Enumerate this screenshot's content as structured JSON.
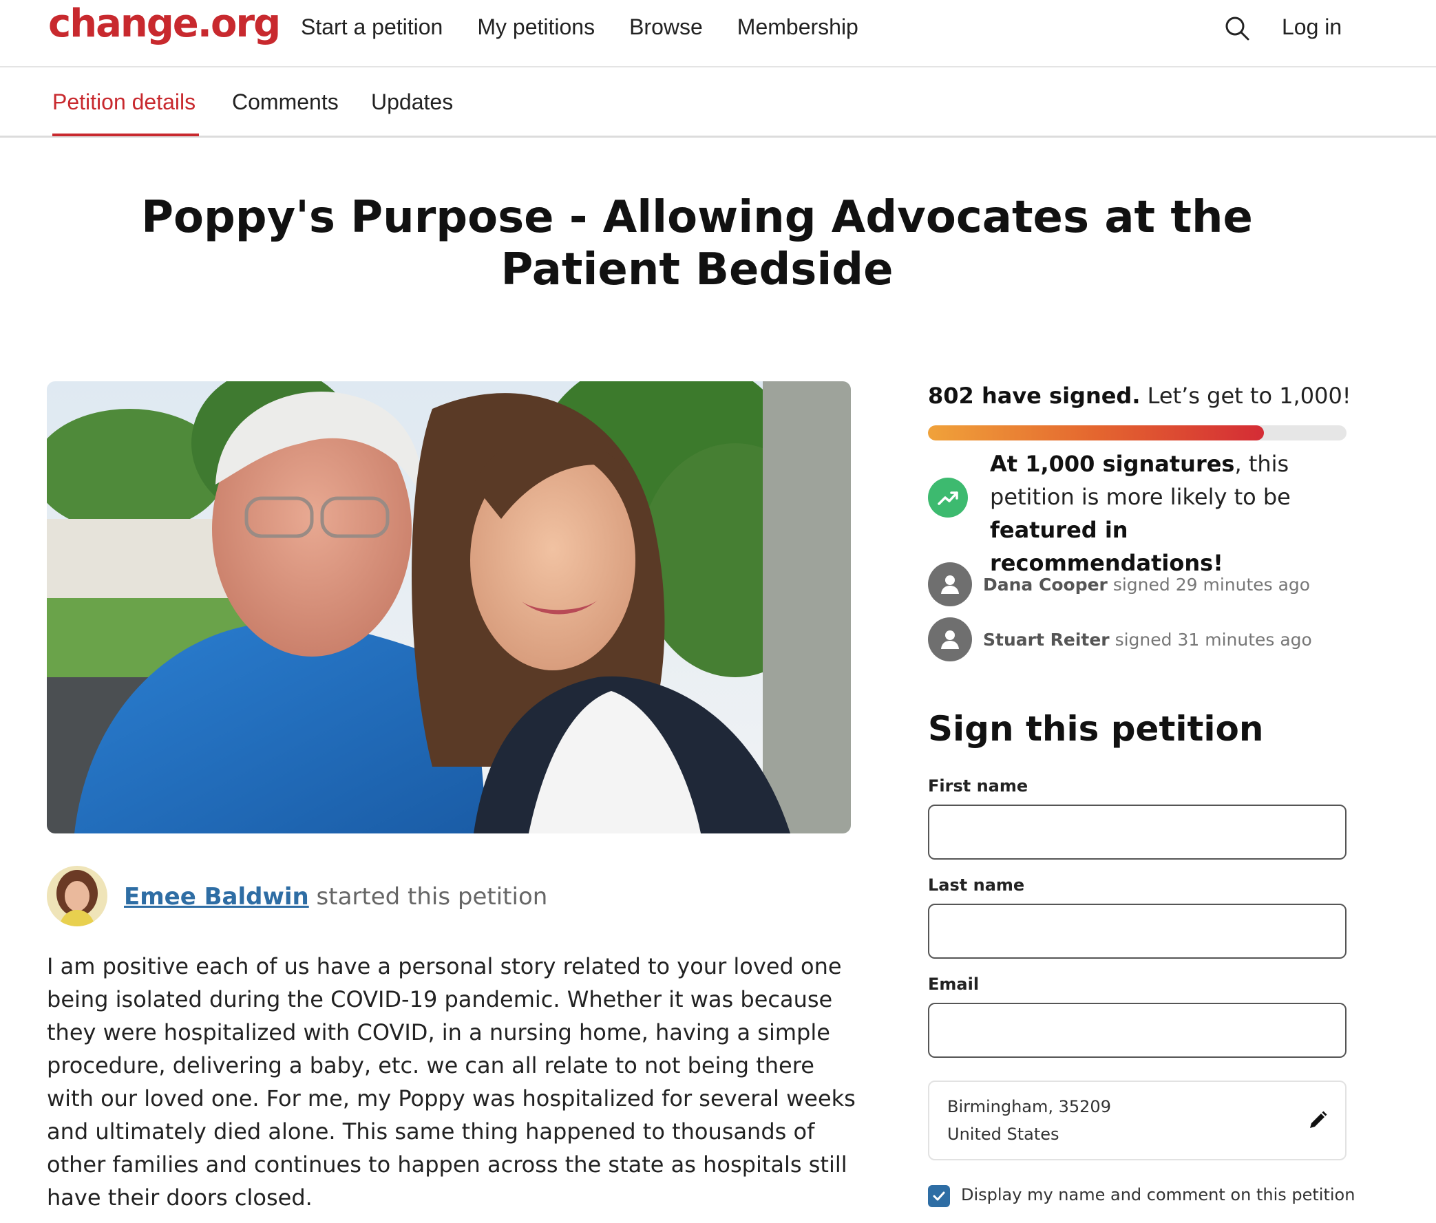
{
  "header": {
    "logo": "change.org",
    "nav": [
      "Start a petition",
      "My petitions",
      "Browse",
      "Membership"
    ],
    "search_icon": "search-icon",
    "login": "Log in"
  },
  "tabs": [
    "Petition details",
    "Comments",
    "Updates"
  ],
  "active_tab": "Petition details",
  "petition": {
    "title": "Poppy's Purpose - Allowing Advocates at the Patient Bedside",
    "starter_name": "Emee Baldwin",
    "starter_action": "started this petition",
    "story": "I am positive each of us have a personal story related to your loved one being isolated during the COVID-19 pandemic. Whether it was because they were hospitalized with COVID, in a nursing home, having a simple procedure, delivering a baby, etc. we can all relate to not being there with our loved one. For me, my Poppy was hospitalized for several weeks and ultimately died alone. This same thing happened to thousands of other families and continues to happen across the state as hospitals still have their doors closed."
  },
  "signatures": {
    "count_text": "802 have signed.",
    "goal_text": "Let’s get to 1,000!",
    "signed": 802,
    "goal": 1000,
    "milestone_bold": "At 1,000 signatures",
    "milestone_rest": ", this petition is more likely to be ",
    "milestone_bold2": "featured in recommendations!",
    "recent": [
      {
        "name": "Dana Cooper",
        "time": "signed 29 minutes ago"
      },
      {
        "name": "Stuart Reiter",
        "time": "signed 31 minutes ago"
      }
    ]
  },
  "form": {
    "heading": "Sign this petition",
    "first_name_label": "First name",
    "last_name_label": "Last name",
    "email_label": "Email",
    "first_name_value": "",
    "last_name_value": "",
    "email_value": "",
    "location_line1": "Birmingham, 35209",
    "location_line2": "United States",
    "display_label": "Display my name and comment on this petition",
    "display_checked": true
  },
  "colors": {
    "brand_red": "#c8292e",
    "link_blue": "#2e6da4",
    "milestone_green": "#3dba6f"
  }
}
